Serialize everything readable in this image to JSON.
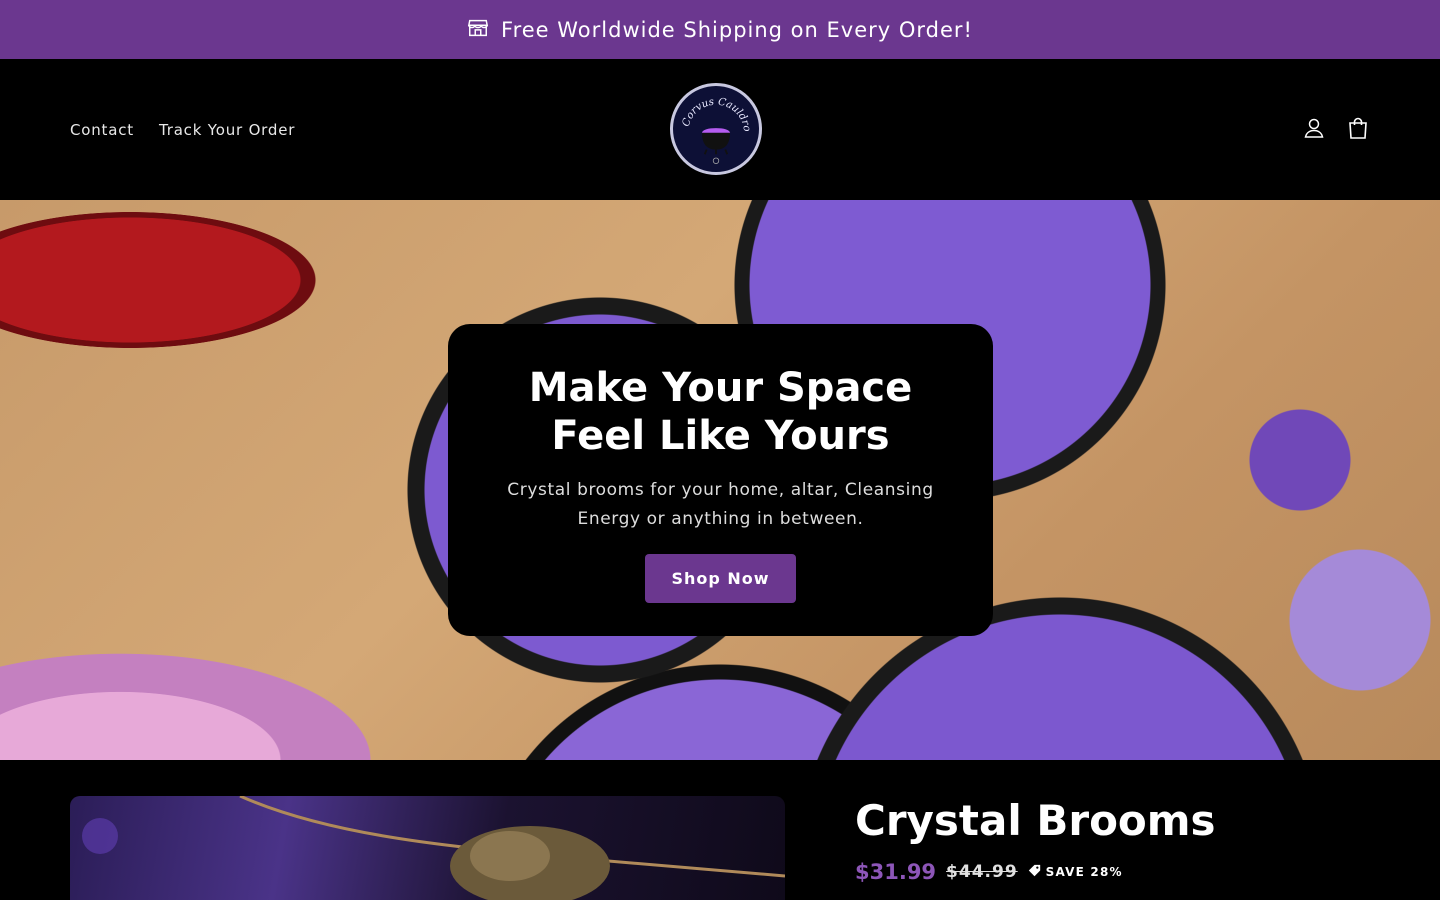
{
  "announcement": {
    "text": "Free Worldwide Shipping on Every Order!",
    "icon": "store-icon"
  },
  "nav": {
    "items": [
      "Contact",
      "Track Your Order"
    ]
  },
  "logo": {
    "text": "Corvus Cauldron"
  },
  "header_icons": [
    "account-icon",
    "cart-icon"
  ],
  "hero": {
    "title": "Make Your Space Feel Like Yours",
    "subtitle": "Crystal brooms for your home, altar, Cleansing Energy or anything in between.",
    "button": "Shop Now"
  },
  "product": {
    "title": "Crystal Brooms",
    "price": "$31.99",
    "compare_price": "$44.99",
    "save_label": "SAVE 28%"
  },
  "colors": {
    "brand_purple": "#6b378f",
    "price_purple": "#8d56b8",
    "background": "#000000"
  }
}
